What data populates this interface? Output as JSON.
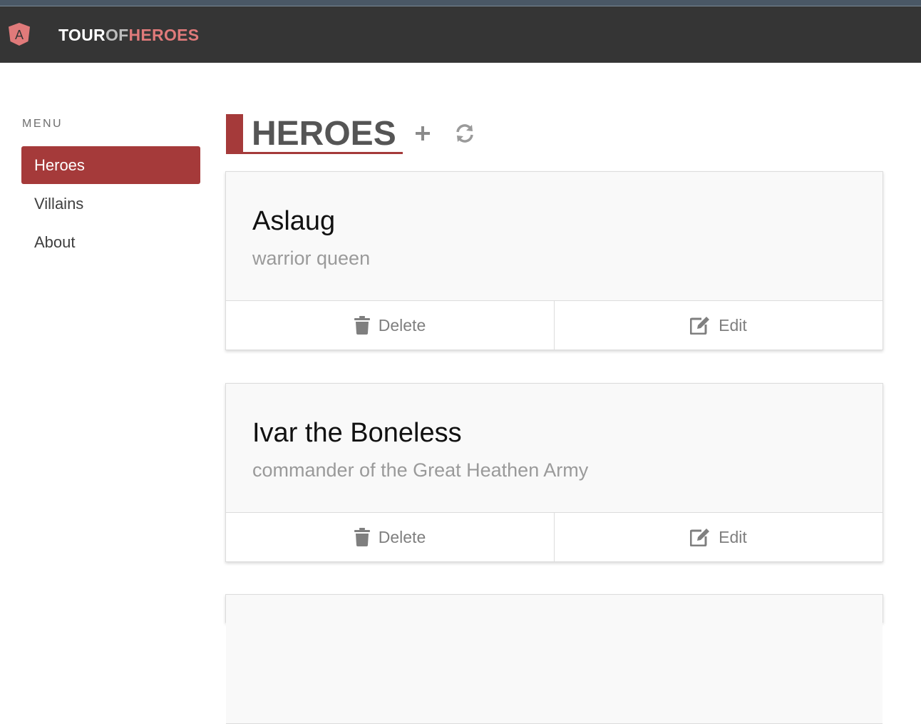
{
  "navbar": {
    "brand_part1": "TOUR",
    "brand_part2": "OF",
    "brand_part3": "HEROES",
    "logo_icon": "angular-icon",
    "logo_letter": "A"
  },
  "sidebar": {
    "label": "MENU",
    "items": [
      {
        "label": "Heroes",
        "active": true
      },
      {
        "label": "Villains",
        "active": false
      },
      {
        "label": "About",
        "active": false
      }
    ]
  },
  "main": {
    "title": "HEROES",
    "add_icon": "plus-icon",
    "refresh_icon": "refresh-icon",
    "heroes": [
      {
        "name": "Aslaug",
        "description": "warrior queen"
      },
      {
        "name": "Ivar the Boneless",
        "description": "commander of the Great Heathen Army"
      }
    ],
    "actions": {
      "delete_label": "Delete",
      "edit_label": "Edit"
    }
  },
  "colors": {
    "accent": "#a53a3a",
    "navbar_bg": "#353535",
    "brand_highlight": "#e07a7a"
  }
}
